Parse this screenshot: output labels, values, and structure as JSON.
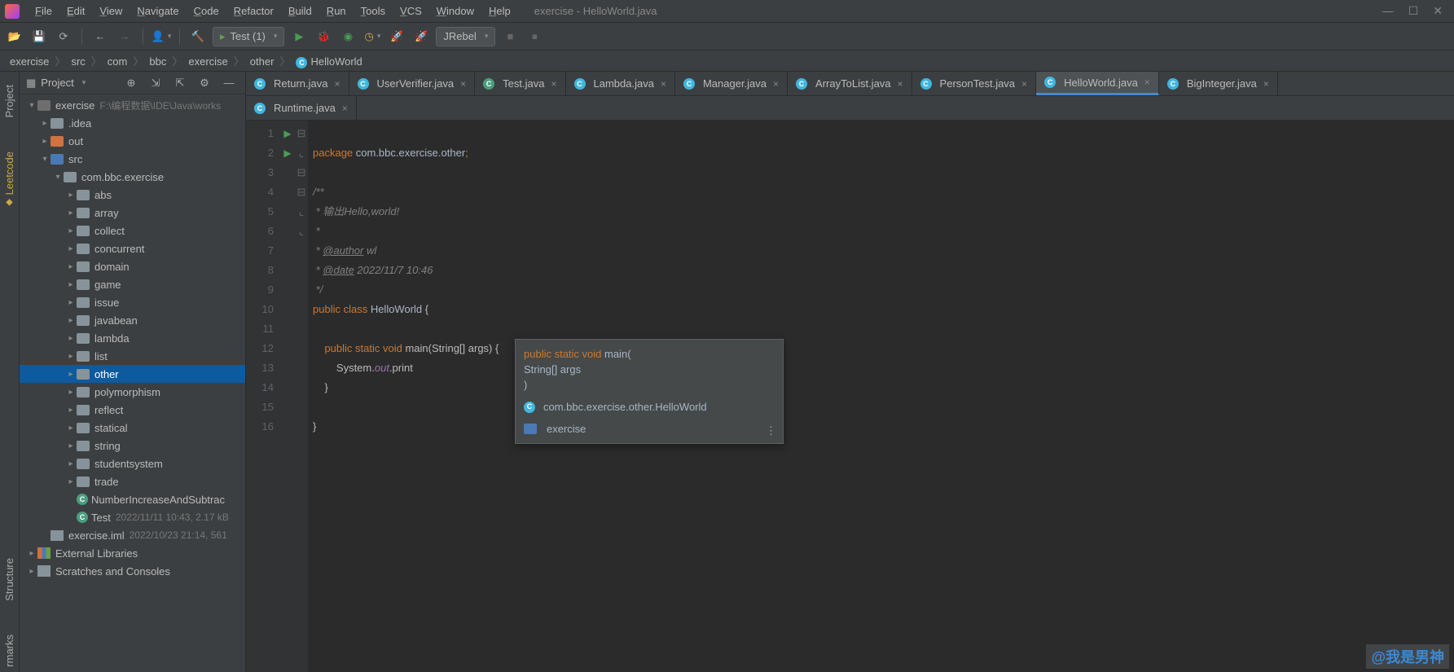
{
  "window": {
    "title": "exercise - HelloWorld.java"
  },
  "menu": [
    "File",
    "Edit",
    "View",
    "Navigate",
    "Code",
    "Refactor",
    "Build",
    "Run",
    "Tools",
    "VCS",
    "Window",
    "Help"
  ],
  "runconfig": {
    "label": "Test (1)"
  },
  "jrebel": {
    "label": "JRebel"
  },
  "breadcrumb": [
    "exercise",
    "src",
    "com",
    "bbc",
    "exercise",
    "other",
    "HelloWorld"
  ],
  "sidebar": {
    "title": "Project",
    "tree": {
      "root": {
        "label": "exercise",
        "path": "F:\\编程数据\\IDE\\Java\\works"
      },
      "idea": ".idea",
      "out": "out",
      "src": "src",
      "pkg": "com.bbc.exercise",
      "dirs": [
        "abs",
        "array",
        "collect",
        "concurrent",
        "domain",
        "game",
        "issue",
        "javabean",
        "lambda",
        "list",
        "other",
        "polymorphism",
        "reflect",
        "statical",
        "string",
        "studentsystem",
        "trade"
      ],
      "classes": [
        {
          "name": "NumberIncreaseAndSubtrac",
          "icon": "teal"
        },
        {
          "name": "Test",
          "icon": "teal",
          "meta": "2022/11/11 10:43, 2.17 kB"
        }
      ],
      "iml": {
        "name": "exercise.iml",
        "meta": "2022/10/23 21:14, 561"
      },
      "extlibs": "External Libraries",
      "scratches": "Scratches and Consoles"
    }
  },
  "tabs_row1": [
    {
      "label": "Return.java",
      "icon": "blue"
    },
    {
      "label": "UserVerifier.java",
      "icon": "blue"
    },
    {
      "label": "Test.java",
      "icon": "teal"
    },
    {
      "label": "Lambda.java",
      "icon": "blue"
    },
    {
      "label": "Manager.java",
      "icon": "blue"
    },
    {
      "label": "ArrayToList.java",
      "icon": "blue"
    },
    {
      "label": "PersonTest.java",
      "icon": "blue"
    },
    {
      "label": "HelloWorld.java",
      "icon": "blue",
      "active": true
    },
    {
      "label": "BigInteger.java",
      "icon": "blue"
    }
  ],
  "tabs_row2": [
    {
      "label": "Runtime.java",
      "icon": "blue"
    }
  ],
  "code": {
    "lines": [
      "1",
      "2",
      "3",
      "4",
      "5",
      "6",
      "7",
      "8",
      "9",
      "10",
      "11",
      "12",
      "13",
      "14",
      "15",
      "16"
    ],
    "l1_kw": "package ",
    "l1_pkg": "com.bbc.exercise.other",
    "l3": "/**",
    "l4": " * 输出Hello,world!",
    "l5": " *",
    "l6_pre": " * ",
    "l6_tag": "@author",
    "l6_val": " wl",
    "l7_pre": " * ",
    "l7_tag": "@date",
    "l7_val": " 2022/11/7 10:46",
    "l8": " */",
    "l9_kw": "public class ",
    "l9_cls": "HelloWorld",
    "l9_b": " {",
    "l11_kw": "    public static void ",
    "l11_m": "main",
    "l11_p": "(String[] args) {",
    "l12_pre": "        System.",
    "l12_field": "out",
    "l12_m": ".print",
    "l13": "    }",
    "l15": "}"
  },
  "tooltip": {
    "sig_kw": "public static void ",
    "sig_m": "main",
    "sig_open": "(",
    "sig_arg": "    String[] args",
    "sig_close": ")",
    "path": "com.bbc.exercise.other.HelloWorld",
    "proj": "exercise"
  },
  "rails": {
    "project": "Project",
    "leetcode": "Leetcode",
    "structure": "Structure",
    "bookmarks": "rmarks"
  },
  "watermark": "@我是男神"
}
